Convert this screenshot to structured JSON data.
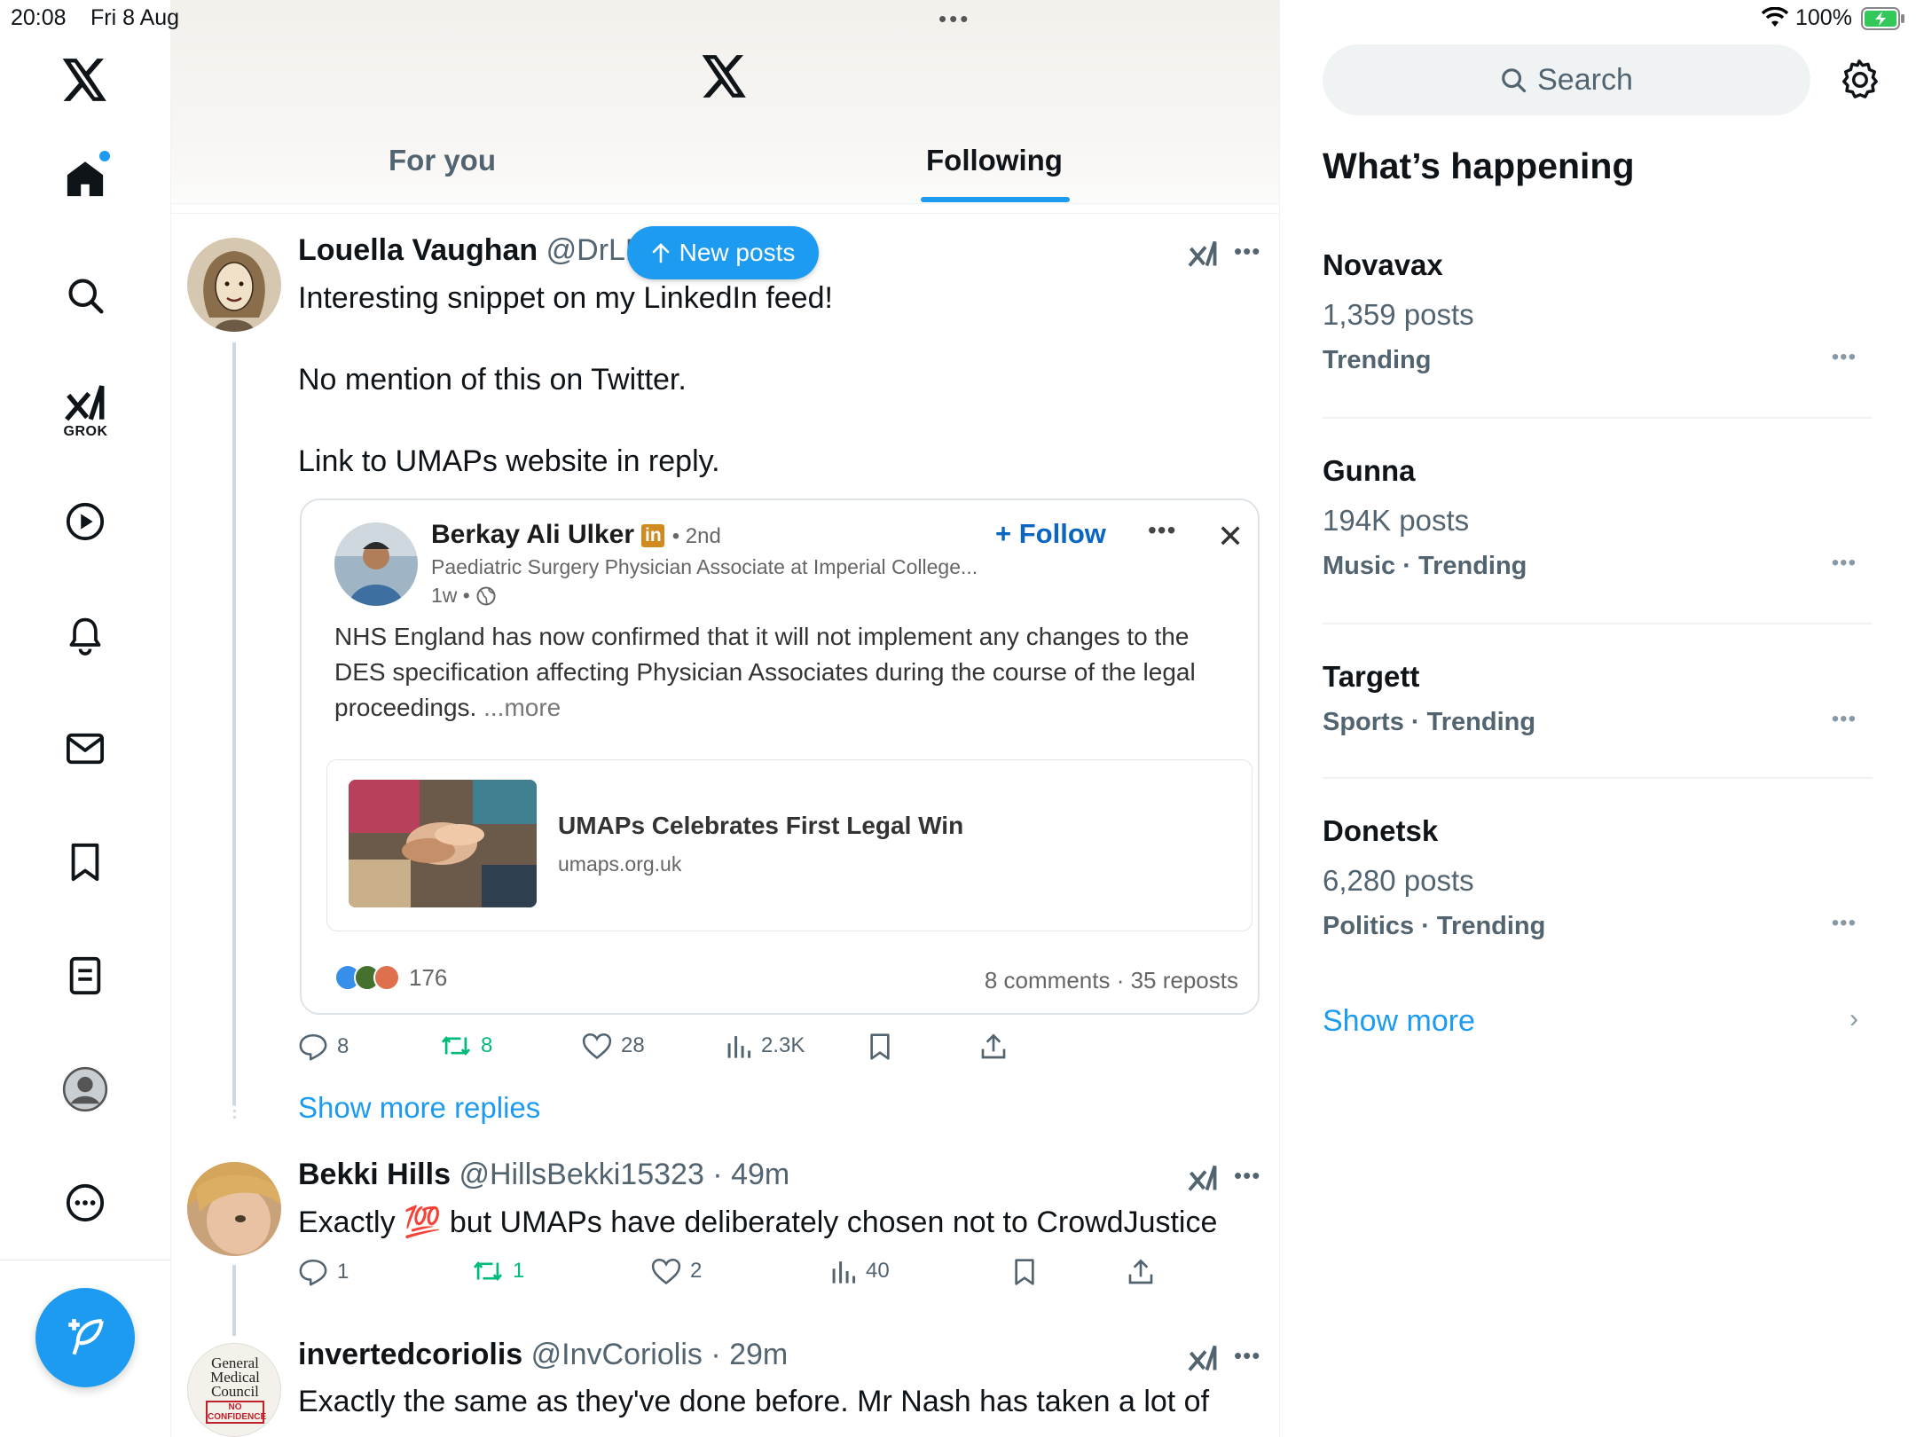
{
  "status_bar": {
    "time": "20:08",
    "date": "Fri 8 Aug",
    "battery": "100%"
  },
  "nav": {
    "grok_label": "GROK",
    "items": [
      "x-logo-icon",
      "home-icon",
      "search-icon",
      "grok-icon",
      "video-icon",
      "notifications-icon",
      "messages-icon",
      "bookmarks-icon",
      "lists-icon",
      "profile-icon",
      "more-icon",
      "compose-icon"
    ]
  },
  "tabs": {
    "for_you": "For you",
    "following": "Following"
  },
  "new_posts_label": "New posts",
  "posts": [
    {
      "name": "Louella Vaughan",
      "handle": "@DrLK",
      "lines": [
        "Interesting snippet on my LinkedIn feed!",
        "No mention of this on Twitter.",
        "Link to UMAPs website in reply."
      ],
      "embed": {
        "author": "Berkay Ali Ulker",
        "badge": "in",
        "degree": "• 2nd",
        "headline": "Paediatric Surgery Physician Associate at Imperial College...",
        "time": "1w •",
        "follow": "Follow",
        "body": "NHS England has now confirmed that it will not implement any changes to the DES specification affecting Physician Associates during the course of the legal proceedings.",
        "more": "...more",
        "link_title": "UMAPs Celebrates First Legal Win",
        "link_domain": "umaps.org.uk",
        "reactions": "176",
        "comments_reposts": "8 comments · 35 reposts"
      },
      "actions": {
        "replies": "8",
        "reposts": "8",
        "likes": "28",
        "views": "2.3K"
      }
    },
    {
      "name": "Bekki Hills",
      "handle": "@HillsBekki15323 · 49m",
      "text_before": "Exactly ",
      "emoji": "💯",
      "text_after": " but UMAPs have deliberately chosen not to CrowdJustice",
      "actions": {
        "replies": "1",
        "reposts": "1",
        "likes": "2",
        "views": "40"
      }
    },
    {
      "name": "invertedcoriolis",
      "handle": "@InvCoriolis · 29m",
      "text": "Exactly the same as they've done before. Mr Nash has taken a lot of",
      "avatar_text": [
        "General",
        "Medical",
        "Council",
        "NO",
        "CONFIDENCE"
      ]
    }
  ],
  "show_more_replies": "Show more replies",
  "right": {
    "search_placeholder": "Search",
    "title": "What’s happening",
    "trends": [
      {
        "name": "Novavax",
        "posts": "1,359 posts",
        "category": "Trending"
      },
      {
        "name": "Gunna",
        "posts": "194K posts",
        "category": "Music · Trending"
      },
      {
        "name": "Targett",
        "posts": "",
        "category": "Sports · Trending"
      },
      {
        "name": "Donetsk",
        "posts": "6,280 posts",
        "category": "Politics · Trending"
      }
    ],
    "show_more": "Show more"
  },
  "colors": {
    "accent": "#1d9bf0",
    "repost": "#00ba7c",
    "linkedin": "#0a66c2"
  }
}
